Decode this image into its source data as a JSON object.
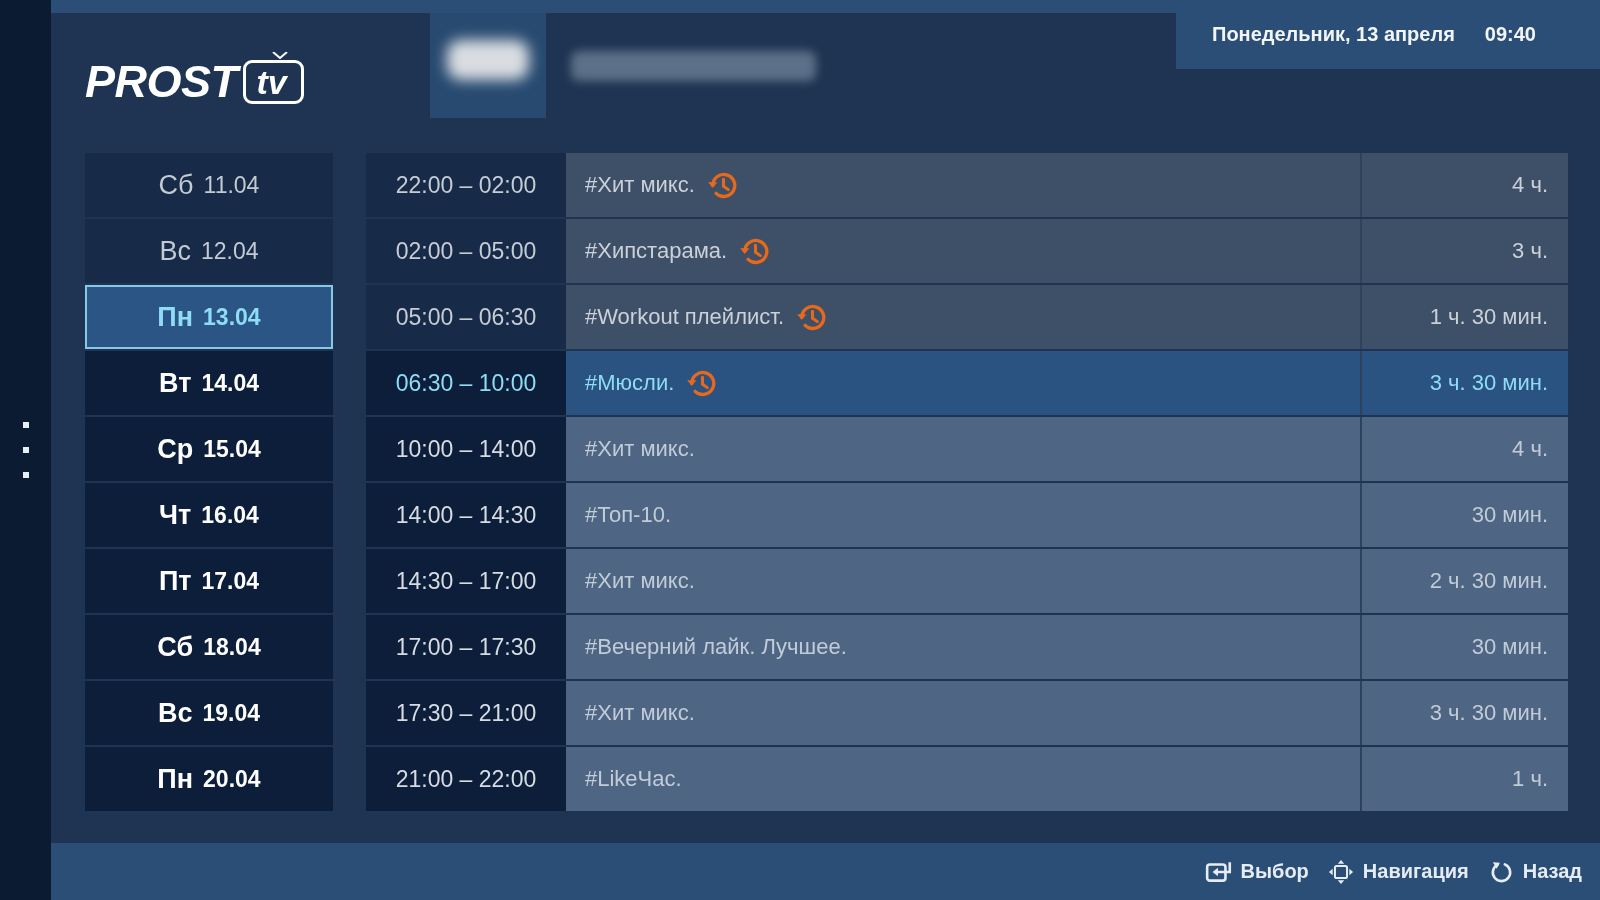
{
  "header": {
    "logo": {
      "text": "PROST",
      "badge": "tv"
    },
    "date": "Понедельник, 13 апреля",
    "time": "09:40"
  },
  "days": [
    {
      "weekday": "Сб",
      "date": "11.04",
      "past": true,
      "selected": false
    },
    {
      "weekday": "Вс",
      "date": "12.04",
      "past": true,
      "selected": false
    },
    {
      "weekday": "Пн",
      "date": "13.04",
      "past": false,
      "selected": true
    },
    {
      "weekday": "Вт",
      "date": "14.04",
      "past": false,
      "selected": false
    },
    {
      "weekday": "Ср",
      "date": "15.04",
      "past": false,
      "selected": false
    },
    {
      "weekday": "Чт",
      "date": "16.04",
      "past": false,
      "selected": false
    },
    {
      "weekday": "Пт",
      "date": "17.04",
      "past": false,
      "selected": false
    },
    {
      "weekday": "Сб",
      "date": "18.04",
      "past": false,
      "selected": false
    },
    {
      "weekday": "Вс",
      "date": "19.04",
      "past": false,
      "selected": false
    },
    {
      "weekday": "Пн",
      "date": "20.04",
      "past": false,
      "selected": false
    }
  ],
  "programs": [
    {
      "time": "22:00 – 02:00",
      "title": "#Хит микс.",
      "duration": "4 ч.",
      "archive": true,
      "past": true,
      "selected": false
    },
    {
      "time": "02:00 – 05:00",
      "title": "#Хипстарама.",
      "duration": "3 ч.",
      "archive": true,
      "past": true,
      "selected": false
    },
    {
      "time": "05:00 – 06:30",
      "title": "#Workout плейлист.",
      "duration": "1 ч. 30 мин.",
      "archive": true,
      "past": true,
      "selected": false
    },
    {
      "time": "06:30 – 10:00",
      "title": "#Мюсли.",
      "duration": "3 ч. 30 мин.",
      "archive": true,
      "past": false,
      "selected": true
    },
    {
      "time": "10:00 – 14:00",
      "title": "#Хит микс.",
      "duration": "4 ч.",
      "archive": false,
      "past": false,
      "selected": false
    },
    {
      "time": "14:00 – 14:30",
      "title": "#Топ-10.",
      "duration": "30 мин.",
      "archive": false,
      "past": false,
      "selected": false
    },
    {
      "time": "14:30 – 17:00",
      "title": "#Хит микс.",
      "duration": "2 ч. 30 мин.",
      "archive": false,
      "past": false,
      "selected": false
    },
    {
      "time": "17:00 – 17:30",
      "title": "#Вечерний лайк. Лучшее.",
      "duration": "30 мин.",
      "archive": false,
      "past": false,
      "selected": false
    },
    {
      "time": "17:30 – 21:00",
      "title": "#Хит микс.",
      "duration": "3 ч. 30 мин.",
      "archive": false,
      "past": false,
      "selected": false
    },
    {
      "time": "21:00 – 22:00",
      "title": "#LikeЧас.",
      "duration": "1 ч.",
      "archive": false,
      "past": false,
      "selected": false
    }
  ],
  "footer": {
    "hints": [
      {
        "kind": "select",
        "label": "Выбор"
      },
      {
        "kind": "navigate",
        "label": "Навигация"
      },
      {
        "kind": "back",
        "label": "Назад"
      }
    ]
  }
}
